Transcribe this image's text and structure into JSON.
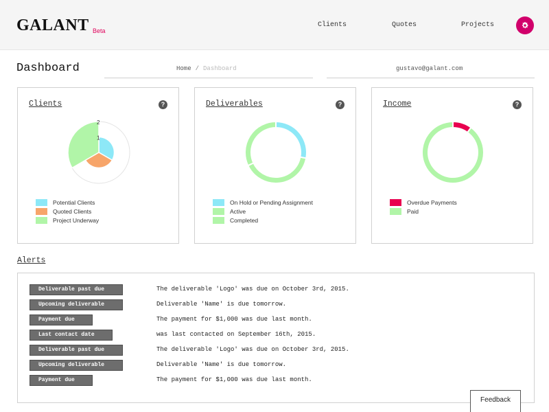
{
  "app": {
    "logo": "GALANT",
    "beta": "Beta"
  },
  "nav": {
    "clients": "Clients",
    "quotes": "Quotes",
    "projects": "Projects",
    "settings_icon": "gear-icon"
  },
  "header": {
    "title": "Dashboard",
    "breadcrumb_home": "Home",
    "breadcrumb_sep": "/",
    "breadcrumb_current": "Dashboard",
    "user_email": "gustavo@galant.com"
  },
  "cards": {
    "clients": {
      "title": "Clients",
      "help": "?",
      "legend": [
        "Potential Clients",
        "Quoted Clients",
        "Project Underway"
      ],
      "colors": [
        "#8de8f7",
        "#f7a56a",
        "#b1f5a8"
      ]
    },
    "deliverables": {
      "title": "Deliverables",
      "help": "?",
      "legend": [
        "On Hold or Pending Assignment",
        "Active",
        "Completed"
      ],
      "colors": [
        "#8de8f7",
        "#b1f5a8",
        "#b1f5a8"
      ]
    },
    "income": {
      "title": "Income",
      "help": "?",
      "legend": [
        "Overdue Payments",
        "Paid"
      ],
      "colors": [
        "#e8004f",
        "#b1f5a8"
      ]
    }
  },
  "chart_data": [
    {
      "type": "polar-area",
      "categories": [
        "Potential Clients",
        "Quoted Clients",
        "Project Underway"
      ],
      "values": [
        1,
        1,
        2
      ],
      "r_ticks": [
        "1",
        "2"
      ],
      "rlim": [
        0,
        2
      ]
    },
    {
      "type": "pie",
      "categories": [
        "On Hold or Pending Assignment",
        "Active",
        "Completed"
      ],
      "values": [
        28,
        40,
        32
      ]
    },
    {
      "type": "pie",
      "categories": [
        "Overdue Payments",
        "Paid"
      ],
      "values": [
        10,
        90
      ]
    }
  ],
  "alerts": {
    "title": "Alerts",
    "items": [
      {
        "label": "Deliverable past due",
        "message": "The deliverable 'Logo' was due on October 3rd, 2015."
      },
      {
        "label": "Upcoming deliverable",
        "message": "Deliverable 'Name' is due tomorrow."
      },
      {
        "label": "Payment due",
        "message": "The payment for $1,000 was due last month."
      },
      {
        "label": "Last contact date",
        "message": "was last contacted on September 16th, 2015."
      },
      {
        "label": "Deliverable past due",
        "message": "The deliverable 'Logo' was due on October 3rd, 2015."
      },
      {
        "label": "Upcoming deliverable",
        "message": "Deliverable 'Name' is due tomorrow."
      },
      {
        "label": "Payment due",
        "message": "The payment for $1,000 was due last month."
      }
    ]
  },
  "feedback": "Feedback"
}
